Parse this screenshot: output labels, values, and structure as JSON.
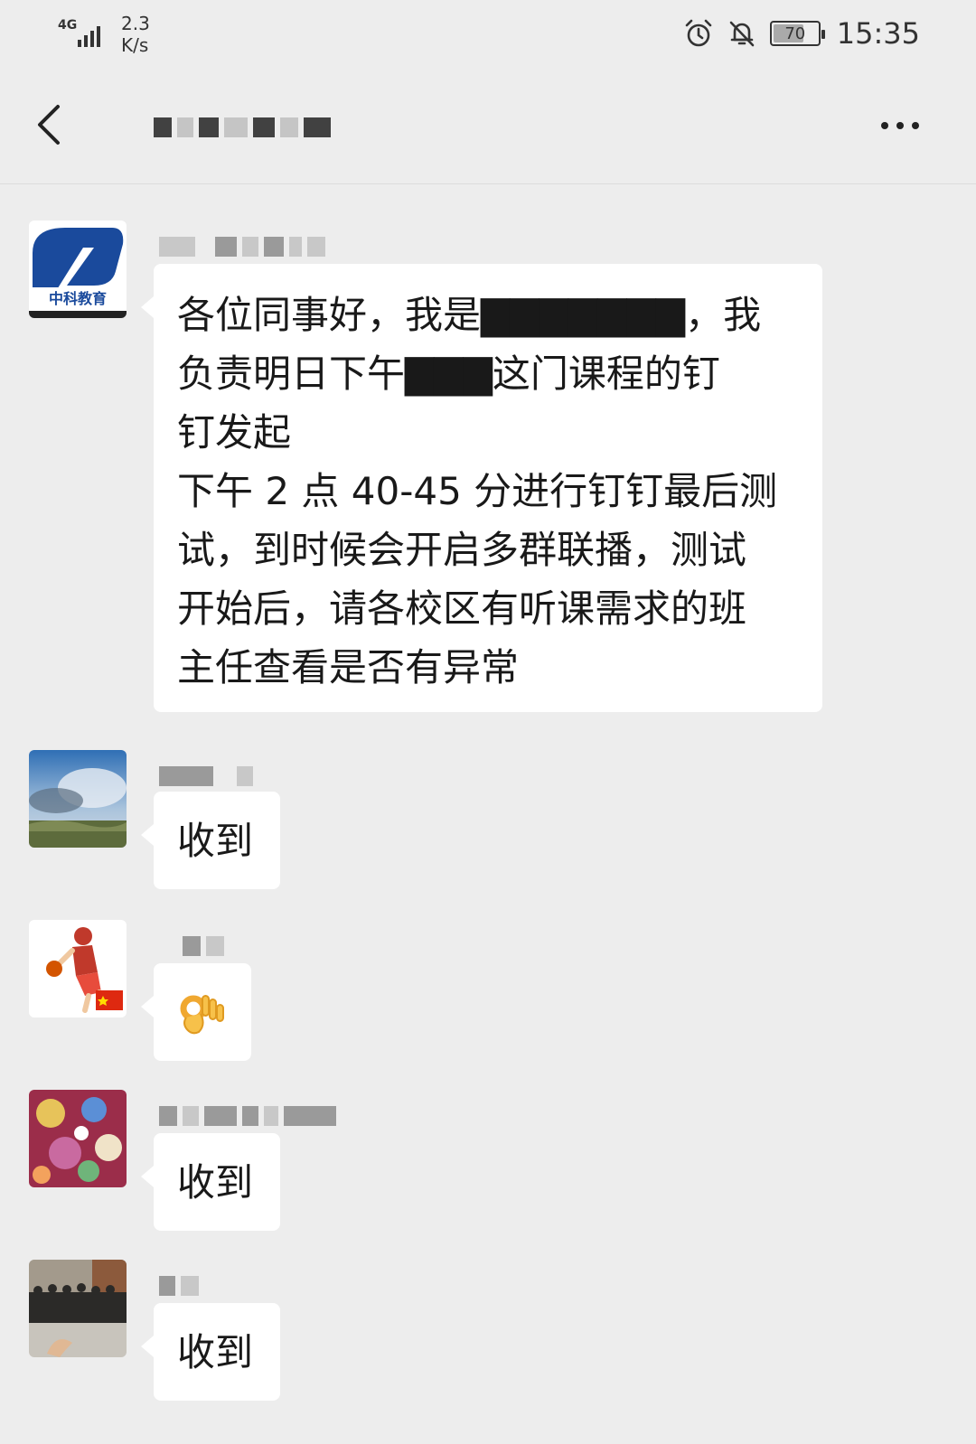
{
  "status_bar": {
    "network": "4G",
    "speed_value": "2.3",
    "speed_unit": "K/s",
    "battery_level": 70,
    "battery_label": "70",
    "time": "15:35",
    "icons": [
      "alarm-icon",
      "mute-icon",
      "battery-icon"
    ]
  },
  "header": {
    "back_icon": "chevron-left-icon",
    "more_icon": "more-icon"
  },
  "messages": [
    {
      "avatar": "zhongke-logo-avatar",
      "avatar_text": "中科教育",
      "text": "各位同事好，我是▇▇▇▇▇▇▇，我\n负责明日下午▇▇▇这门课程的钉\n钉发起\n下午 2 点 40-45 分进行钉钉最后测\n试，到时候会开启多群联播，测试\n开始后，请各校区有听课需求的班\n主任查看是否有异常"
    },
    {
      "avatar": "sky-landscape-avatar",
      "text": "收到"
    },
    {
      "avatar": "basketball-player-avatar",
      "emoji": "👌"
    },
    {
      "avatar": "colorful-collage-avatar",
      "text": "收到"
    },
    {
      "avatar": "group-photo-avatar",
      "text": "收到"
    }
  ],
  "colors": {
    "background": "#ededed",
    "bubble": "#ffffff",
    "text": "#191919",
    "logo_blue": "#1a4a9c"
  }
}
